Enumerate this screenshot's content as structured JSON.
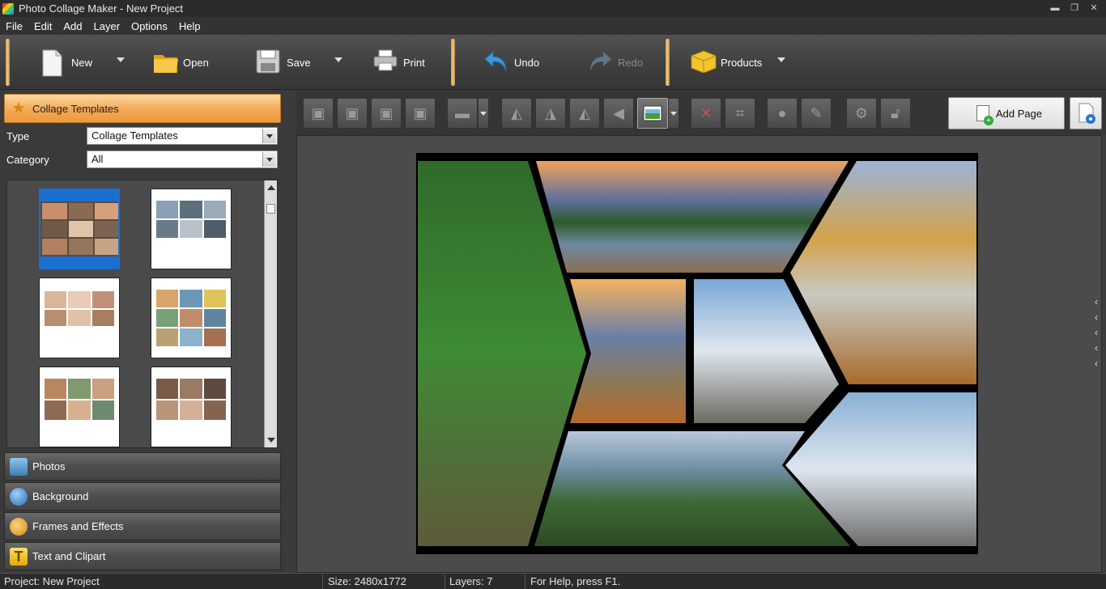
{
  "window": {
    "title": "Photo Collage Maker - New Project"
  },
  "menu": [
    "File",
    "Edit",
    "Add",
    "Layer",
    "Options",
    "Help"
  ],
  "ribbon": {
    "new_label": "New",
    "open_label": "Open",
    "save_label": "Save",
    "print_label": "Print",
    "undo_label": "Undo",
    "redo_label": "Redo",
    "products_label": "Products"
  },
  "left_panel": {
    "header": "Collage Templates",
    "type_label": "Type",
    "type_value": "Collage Templates",
    "category_label": "Category",
    "category_value": "All",
    "sections": [
      "Photos",
      "Background",
      "Frames and Effects",
      "Text and Clipart"
    ]
  },
  "toolbar": {
    "add_page_label": "Add Page"
  },
  "status": {
    "project": "Project: New Project",
    "size": "Size: 2480x1772",
    "layers": "Layers: 7",
    "help": "For Help, press F1."
  },
  "colors": {
    "accent": "#f3a955",
    "selection": "#1a6fd1"
  }
}
